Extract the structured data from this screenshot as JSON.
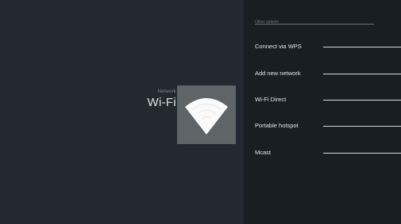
{
  "header": {
    "subtitle": "Network",
    "title": "Wi-Fi",
    "icon": "wifi-icon"
  },
  "options": {
    "section_label": "Other options",
    "items": [
      {
        "label": "Connect via WPS"
      },
      {
        "label": "Add new network"
      },
      {
        "label": "Wi-Fi Direct"
      },
      {
        "label": "Portable hotspot"
      },
      {
        "label": "Mcast"
      }
    ]
  },
  "colors": {
    "background": "#20262c",
    "panel": "#191e23",
    "tile": "#5f6467",
    "text": "#e4e7ea"
  }
}
